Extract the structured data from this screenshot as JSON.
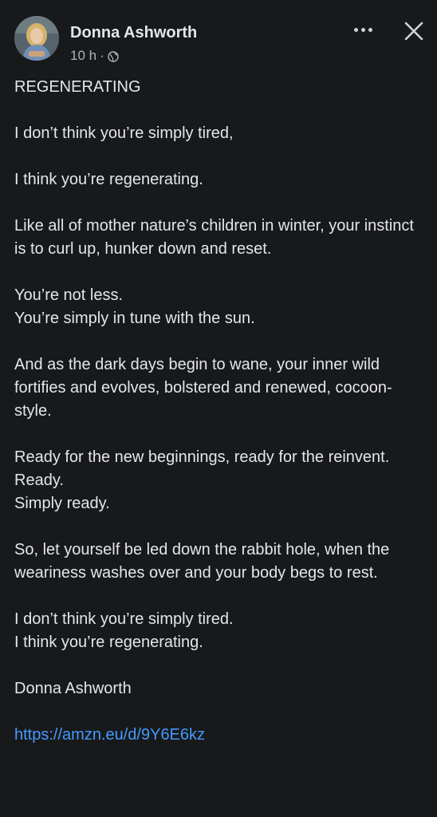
{
  "post": {
    "author": "Donna Ashworth",
    "time": "10 h",
    "separator": "·",
    "privacy_icon": "globe-icon",
    "title": "REGENERATING",
    "line_1": "I don’t think you’re simply tired,",
    "line_2": "I think you’re regenerating.",
    "line_3": "Like all of mother nature’s children in winter, your instinct is to curl up, hunker down and reset.",
    "line_4": "You’re not less.",
    "line_5": "You’re simply in tune with the sun.",
    "line_6": "And as the dark days begin to wane, your inner wild fortifies and evolves, bolstered and renewed, cocoon-style.",
    "line_7": "Ready for the new beginnings, ready for the reinvent.",
    "line_8": "Ready.",
    "line_9": "Simply ready.",
    "line_10": "So, let yourself be led down the rabbit hole, when the weariness washes over and your body begs to rest.",
    "line_11": "I don’t think you’re simply tired.",
    "line_12": "I think you’re regenerating.",
    "signature": "Donna Ashworth",
    "link": "https://amzn.eu/d/9Y6E6kz"
  },
  "colors": {
    "background": "#18191a",
    "text": "#e4e6eb",
    "secondary_text": "#b0b3b8",
    "link": "#4599ff"
  }
}
